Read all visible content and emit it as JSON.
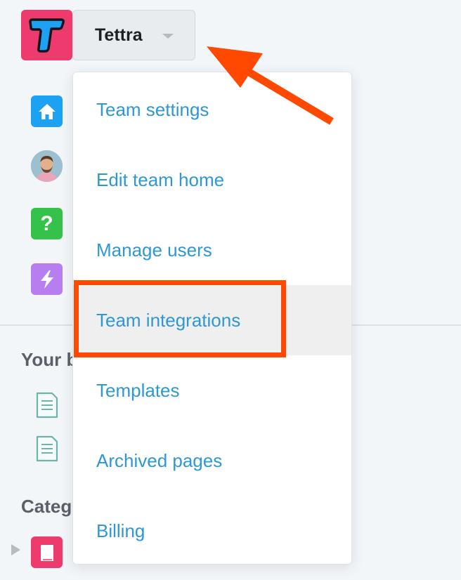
{
  "app": {
    "logo_icon": "tettra-logo-icon",
    "team_name": "Tettra"
  },
  "sidebar": {
    "nav_icons": [
      "home-icon",
      "avatar",
      "help-icon",
      "bolt-icon"
    ],
    "sections": {
      "yours_label": "Your b",
      "categories_label": "Categ"
    }
  },
  "dropdown": {
    "items": [
      {
        "label": "Team settings"
      },
      {
        "label": "Edit team home"
      },
      {
        "label": "Manage users"
      },
      {
        "label": "Team integrations",
        "hovered": true
      },
      {
        "label": "Templates"
      },
      {
        "label": "Archived pages"
      },
      {
        "label": "Billing"
      }
    ]
  },
  "colors": {
    "link": "#2e97d4",
    "annotation": "#ff4800",
    "brand_pink": "#ee3b6d"
  }
}
